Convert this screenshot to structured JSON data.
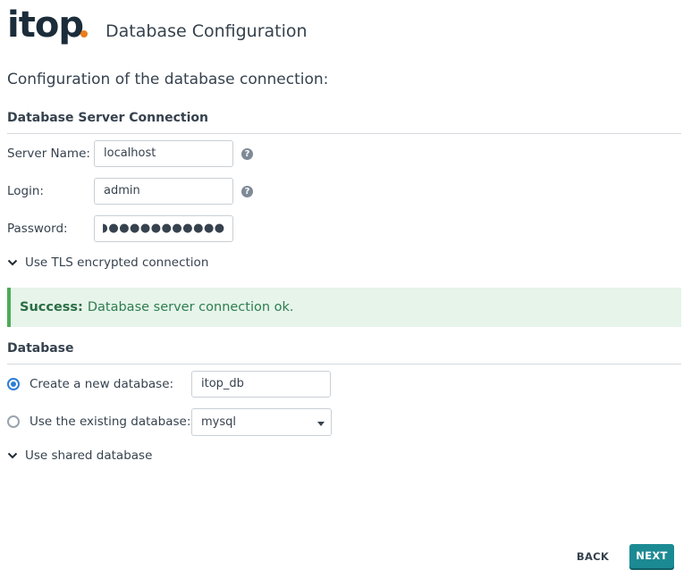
{
  "header": {
    "logo_text": "itop",
    "title": "Database Configuration"
  },
  "subtitle": "Configuration of the database connection:",
  "server_section": {
    "title": "Database Server Connection",
    "server_name_label": "Server Name:",
    "server_name_value": "localhost",
    "login_label": "Login:",
    "login_value": "admin",
    "password_label": "Password:",
    "password_value": "◗●●●●●●●●●●●",
    "help_icon": "question-circle-icon",
    "tls_toggle_label": "Use TLS encrypted connection"
  },
  "alert": {
    "prefix": "Success:",
    "message": "Database server connection ok."
  },
  "database_section": {
    "title": "Database",
    "create_label": "Create a new database:",
    "create_value": "itop_db",
    "existing_label": "Use the existing database:",
    "existing_selected": "mysql",
    "shared_toggle_label": "Use shared database"
  },
  "footer": {
    "back_label": "BACK",
    "next_label": "NEXT"
  },
  "colors": {
    "accent": "#1c8a93",
    "logo_dot": "#ea7d1e",
    "success_bg": "#e6f4ea",
    "success_border": "#4eaa57",
    "radio_selected": "#2d7ed3"
  }
}
